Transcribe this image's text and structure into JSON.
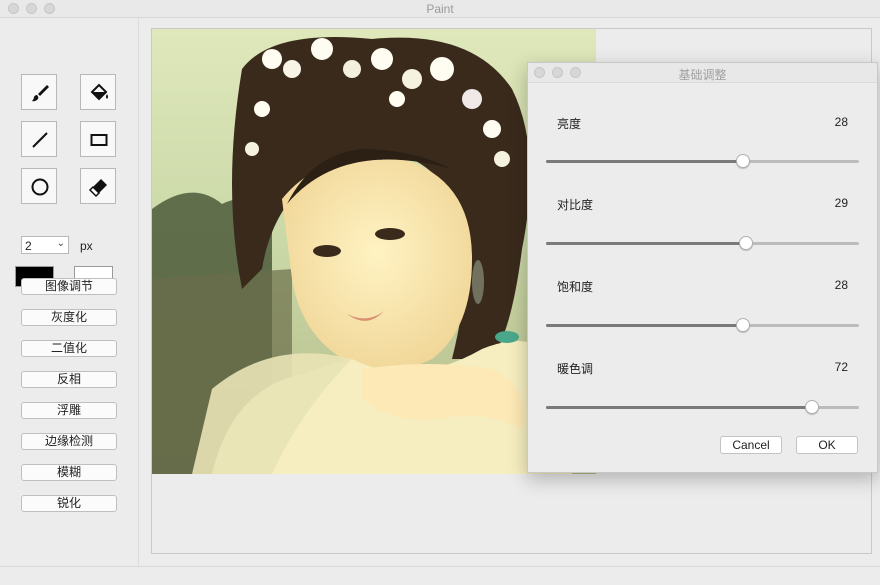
{
  "window": {
    "title": "Paint"
  },
  "toolbar": {
    "tools": [
      {
        "name": "brush-icon"
      },
      {
        "name": "fill-bucket-icon"
      },
      {
        "name": "line-icon"
      },
      {
        "name": "rectangle-icon"
      },
      {
        "name": "circle-icon"
      },
      {
        "name": "eraser-icon"
      }
    ],
    "brush_size": "2",
    "size_unit": "px",
    "primary_color": "#000000",
    "secondary_color": "#ffffff"
  },
  "actions": [
    "图像调节",
    "灰度化",
    "二值化",
    "反相",
    "浮雕",
    "边缘检测",
    "模糊",
    "锐化"
  ],
  "dialog": {
    "title": "基础调整",
    "sliders": [
      {
        "label": "亮度",
        "value": "28",
        "level": 0.63
      },
      {
        "label": "对比度",
        "value": "29",
        "level": 0.64
      },
      {
        "label": "饱和度",
        "value": "28",
        "level": 0.63
      },
      {
        "label": "暖色调",
        "value": "72",
        "level": 0.85
      }
    ],
    "cancel_label": "Cancel",
    "ok_label": "OK"
  }
}
